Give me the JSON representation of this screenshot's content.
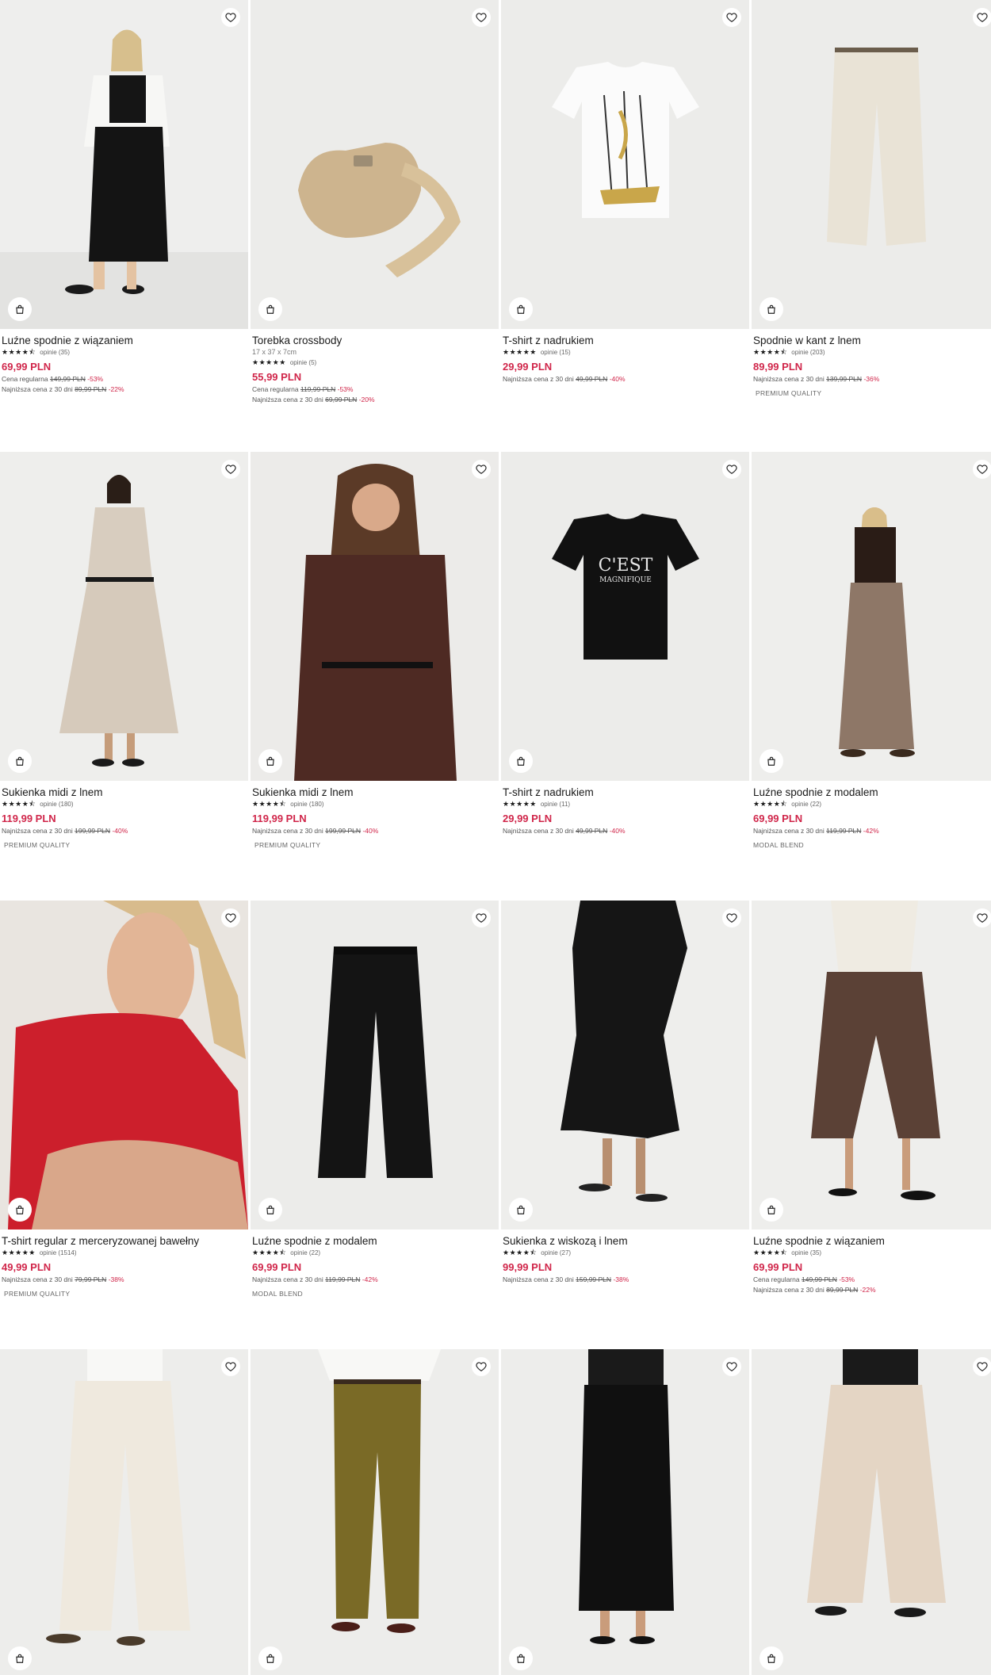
{
  "colors": {
    "price": "#d0264a",
    "image_bg": "#ececec",
    "text": "#1a1a1a"
  },
  "icons": {
    "wishlist": "heart-icon",
    "cart": "shopping-bag-icon",
    "rating": "star-icon"
  },
  "products": [
    {
      "name": "Luźne spodnie z wiązaniem",
      "stars": "★★★★⯪",
      "reviews": "opinie (35)",
      "price": "69,99 PLN",
      "regular_label": "Cena regularna",
      "regular_price": "149,99 PLN",
      "regular_discount": "-53%",
      "lowest_label": "Najniższa cena z 30 dni",
      "lowest_price": "89,99 PLN",
      "lowest_discount": "-22%"
    },
    {
      "name": "Torebka crossbody",
      "dims": "17 x 37 x 7cm",
      "stars": "★★★★★",
      "reviews": "opinie (5)",
      "price": "55,99 PLN",
      "regular_label": "Cena regularna",
      "regular_price": "119,99 PLN",
      "regular_discount": "-53%",
      "lowest_label": "Najniższa cena z 30 dni",
      "lowest_price": "69,99 PLN",
      "lowest_discount": "-20%"
    },
    {
      "name": "T-shirt z nadrukiem",
      "stars": "★★★★★",
      "reviews": "opinie (15)",
      "price": "29,99 PLN",
      "lowest_label": "Najniższa cena z 30 dni",
      "lowest_price": "49,99 PLN",
      "lowest_discount": "-40%"
    },
    {
      "name": "Spodnie w kant z lnem",
      "stars": "★★★★⯪",
      "reviews": "opinie (203)",
      "price": "89,99 PLN",
      "lowest_label": "Najniższa cena z 30 dni",
      "lowest_price": "139,99 PLN",
      "lowest_discount": "-36%",
      "badge": "PREMIUM QUALITY"
    },
    {
      "name": "Sukienka midi z lnem",
      "stars": "★★★★⯪",
      "reviews": "opinie (180)",
      "price": "119,99 PLN",
      "lowest_label": "Najniższa cena z 30 dni",
      "lowest_price": "199,99 PLN",
      "lowest_discount": "-40%",
      "badge": "PREMIUM QUALITY"
    },
    {
      "name": "Sukienka midi z lnem",
      "stars": "★★★★⯪",
      "reviews": "opinie (180)",
      "price": "119,99 PLN",
      "lowest_label": "Najniższa cena z 30 dni",
      "lowest_price": "199,99 PLN",
      "lowest_discount": "-40%",
      "badge": "PREMIUM QUALITY"
    },
    {
      "name": "T-shirt z nadrukiem",
      "stars": "★★★★★",
      "reviews": "opinie (11)",
      "price": "29,99 PLN",
      "lowest_label": "Najniższa cena z 30 dni",
      "lowest_price": "49,99 PLN",
      "lowest_discount": "-40%"
    },
    {
      "name": "Luźne spodnie z modalem",
      "stars": "★★★★⯪",
      "reviews": "opinie (22)",
      "price": "69,99 PLN",
      "lowest_label": "Najniższa cena z 30 dni",
      "lowest_price": "119,99 PLN",
      "lowest_discount": "-42%",
      "badge": "MODAL BLEND"
    },
    {
      "name": "T-shirt regular z merceryzowanej bawełny",
      "stars": "★★★★★",
      "reviews": "opinie (1514)",
      "price": "49,99 PLN",
      "lowest_label": "Najniższa cena z 30 dni",
      "lowest_price": "79,99 PLN",
      "lowest_discount": "-38%",
      "badge": "PREMIUM QUALITY"
    },
    {
      "name": "Luźne spodnie z modalem",
      "stars": "★★★★⯪",
      "reviews": "opinie (22)",
      "price": "69,99 PLN",
      "lowest_label": "Najniższa cena z 30 dni",
      "lowest_price": "119,99 PLN",
      "lowest_discount": "-42%",
      "badge": "MODAL BLEND"
    },
    {
      "name": "Sukienka z wiskozą i lnem",
      "stars": "★★★★⯪",
      "reviews": "opinie (27)",
      "price": "99,99 PLN",
      "lowest_label": "Najniższa cena z 30 dni",
      "lowest_price": "159,99 PLN",
      "lowest_discount": "-38%"
    },
    {
      "name": "Luźne spodnie z wiązaniem",
      "stars": "★★★★⯪",
      "reviews": "opinie (35)",
      "price": "69,99 PLN",
      "regular_label": "Cena regularna",
      "regular_price": "149,99 PLN",
      "regular_discount": "-53%",
      "lowest_label": "Najniższa cena z 30 dni",
      "lowest_price": "89,99 PLN",
      "lowest_discount": "-22%"
    },
    {},
    {},
    {},
    {}
  ],
  "image_text": {
    "tshirt_print_1": "C'EST",
    "tshirt_print_2": "MAGNIFIQUE"
  }
}
